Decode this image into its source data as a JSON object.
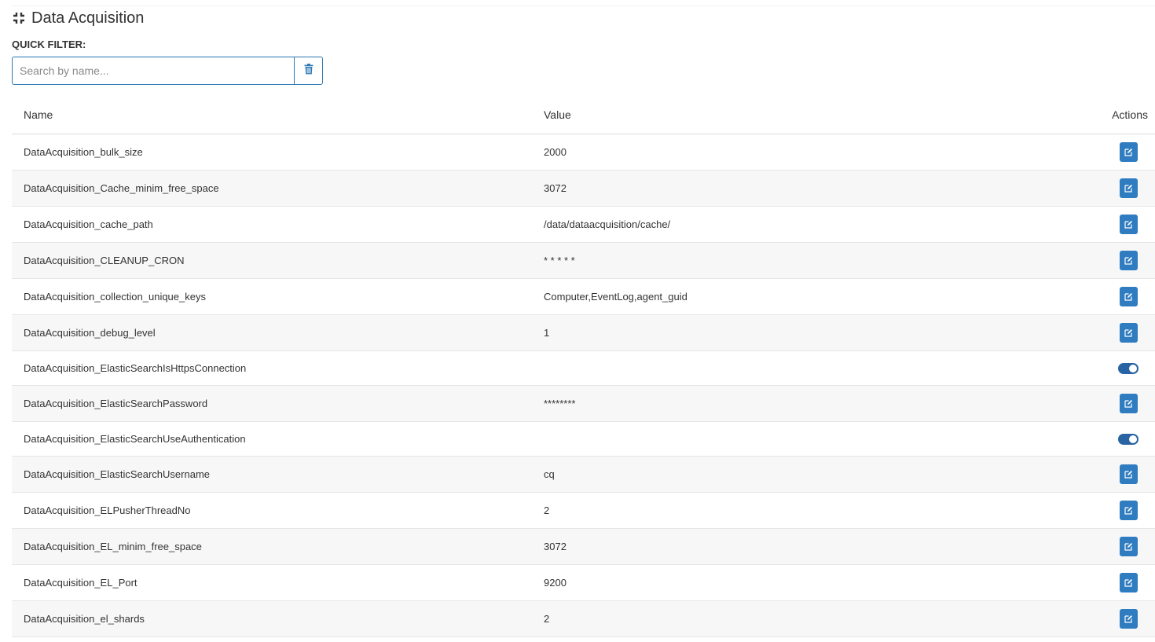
{
  "header": {
    "title": "Data Acquisition",
    "icon": "collapse-icon"
  },
  "quick_filter": {
    "label": "QUICK FILTER:",
    "search_placeholder": "Search by name...",
    "search_value": "",
    "clear_icon": "trash-icon",
    "accent_color": "#2b78b5"
  },
  "table": {
    "columns": {
      "name": "Name",
      "value": "Value",
      "actions": "Actions"
    },
    "rows": [
      {
        "name": "DataAcquisition_bulk_size",
        "value": "2000",
        "action": "edit"
      },
      {
        "name": "DataAcquisition_Cache_minim_free_space",
        "value": "3072",
        "action": "edit"
      },
      {
        "name": "DataAcquisition_cache_path",
        "value": "/data/dataacquisition/cache/",
        "action": "edit"
      },
      {
        "name": "DataAcquisition_CLEANUP_CRON",
        "value": "* * * * *",
        "action": "edit"
      },
      {
        "name": "DataAcquisition_collection_unique_keys",
        "value": "Computer,EventLog,agent_guid",
        "action": "edit"
      },
      {
        "name": "DataAcquisition_debug_level",
        "value": "1",
        "action": "edit"
      },
      {
        "name": "DataAcquisition_ElasticSearchIsHttpsConnection",
        "value": "",
        "action": "toggle",
        "toggle_on": true
      },
      {
        "name": "DataAcquisition_ElasticSearchPassword",
        "value": "********",
        "action": "edit"
      },
      {
        "name": "DataAcquisition_ElasticSearchUseAuthentication",
        "value": "",
        "action": "toggle",
        "toggle_on": true
      },
      {
        "name": "DataAcquisition_ElasticSearchUsername",
        "value": "cq",
        "action": "edit"
      },
      {
        "name": "DataAcquisition_ELPusherThreadNo",
        "value": "2",
        "action": "edit"
      },
      {
        "name": "DataAcquisition_EL_minim_free_space",
        "value": "3072",
        "action": "edit"
      },
      {
        "name": "DataAcquisition_EL_Port",
        "value": "9200",
        "action": "edit"
      },
      {
        "name": "DataAcquisition_el_shards",
        "value": "2",
        "action": "edit"
      }
    ],
    "edit_icon": "edit-icon",
    "button_color": "#2f7cc0",
    "toggle_color": "#2864a3"
  }
}
